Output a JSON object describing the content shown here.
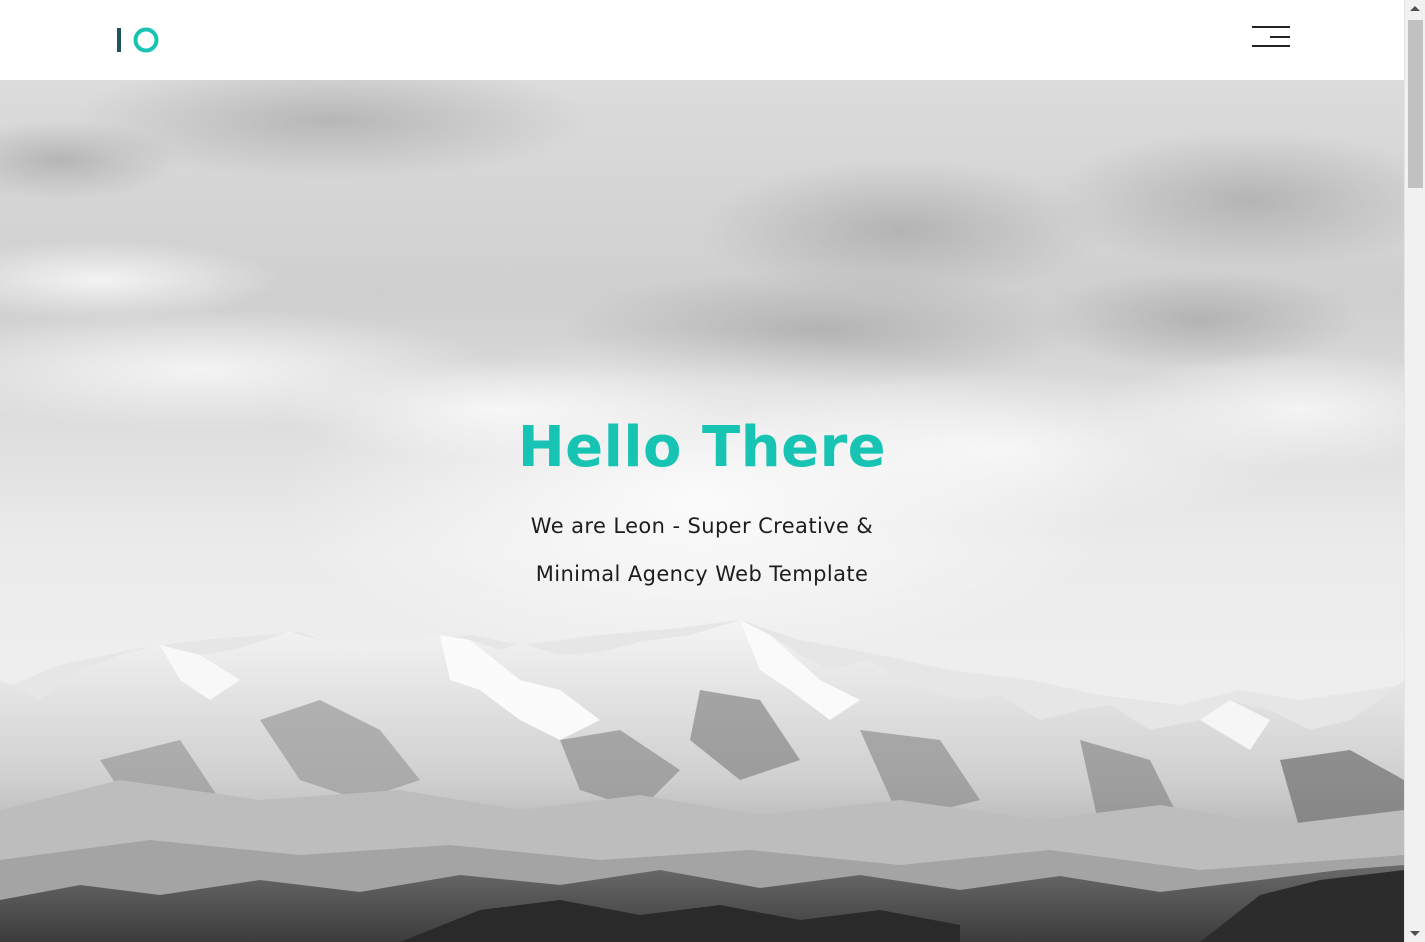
{
  "header": {
    "logo_text": "IO",
    "menu_icon": "hamburger-menu-icon"
  },
  "hero": {
    "title": "Hello There",
    "subtitle": "We are Leon - Super Creative & Minimal Agency Web Template",
    "background": "snowy-mountains-grayscale-photo"
  },
  "colors": {
    "accent": "#17c3b2",
    "logo_bar": "#1a5560",
    "text_dark": "#1d1d1d",
    "header_bg": "#ffffff"
  }
}
